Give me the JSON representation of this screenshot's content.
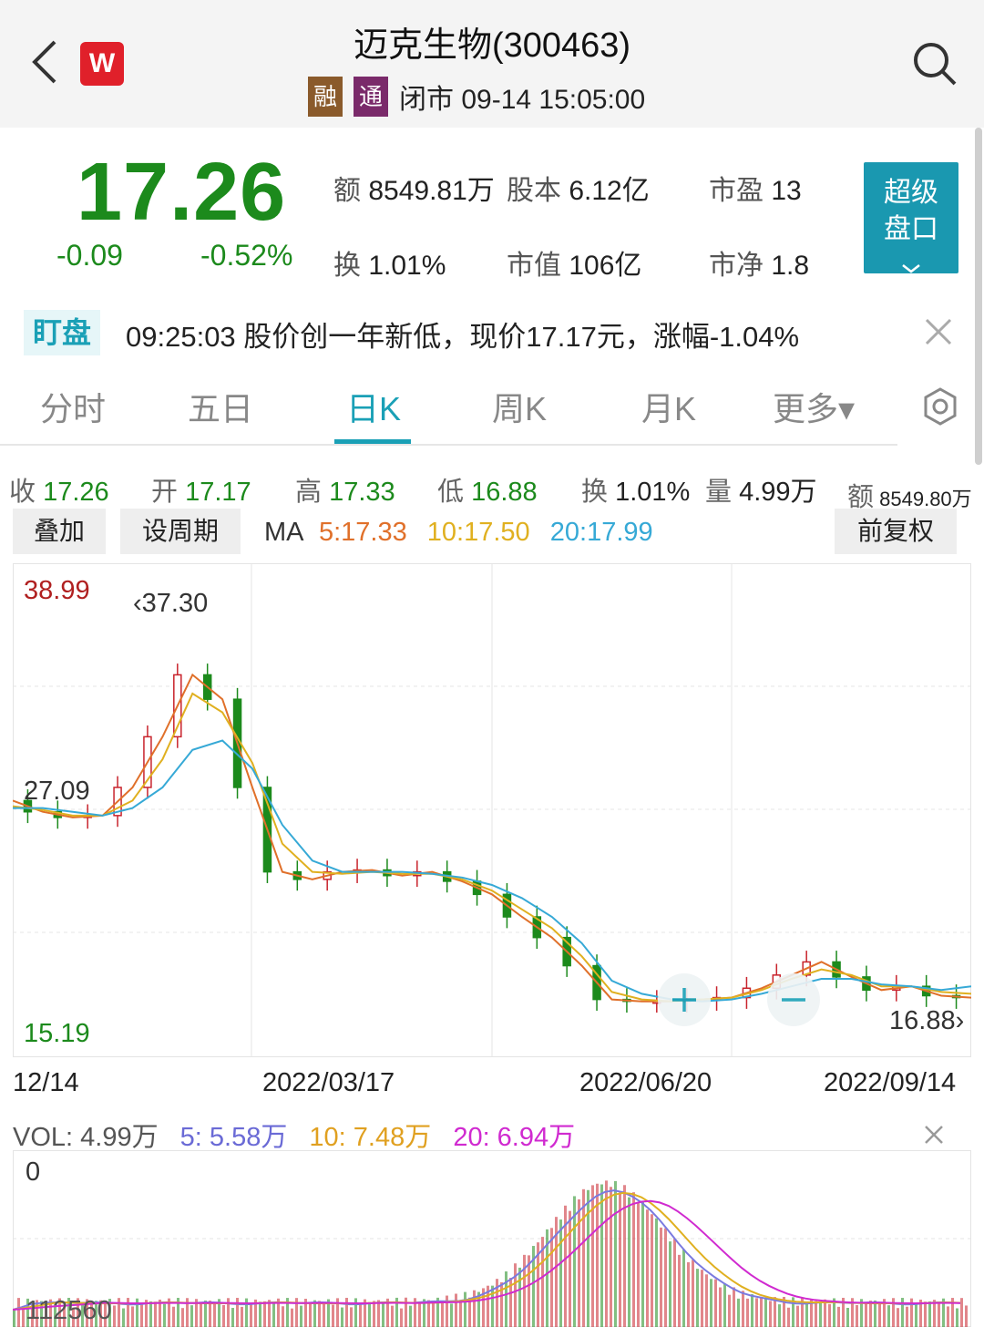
{
  "header": {
    "title": "迈克生物(300463)",
    "tag_rong": "融",
    "tag_tong": "通",
    "status": "闭市 09-14 15:05:00",
    "logo_letter": "W",
    "icons": [
      "back-arrow-icon",
      "search-icon"
    ]
  },
  "quote": {
    "price": "17.26",
    "change": "-0.09",
    "change_pct": "-0.52%",
    "amount_label": "额",
    "amount": "8549.81万",
    "capital_label": "股本",
    "capital": "6.12亿",
    "pe_label": "市盈",
    "pe": "13",
    "turnover_label": "换",
    "turnover": "1.01%",
    "mcap_label": "市值",
    "mcap": "106亿",
    "pb_label": "市净",
    "pb": "1.8",
    "super_line1": "超级",
    "super_line2": "盘口"
  },
  "alert": {
    "badge": "盯盘",
    "text": "09:25:03 股价创一年新低，现价17.17元，涨幅-1.04%"
  },
  "tabs": [
    "分时",
    "五日",
    "日K",
    "周K",
    "月K",
    "更多▾"
  ],
  "active_tab": "日K",
  "ohlc": {
    "close_k": "收",
    "close": "17.26",
    "open_k": "开",
    "open": "17.17",
    "high_k": "高",
    "high": "17.33",
    "low_k": "低",
    "low": "16.88",
    "turn_k": "换",
    "turn": "1.01%",
    "vol_k": "量",
    "vol": "4.99万",
    "amt_k": "额",
    "amt": "8549.80万"
  },
  "toolbar": {
    "overlay": "叠加",
    "period": "设周期",
    "adjust": "前复权"
  },
  "ma": {
    "label": "MA",
    "ma5": "5:17.33",
    "ma10": "10:17.50",
    "ma20": "20:17.99"
  },
  "colors": {
    "up": "#c8232c",
    "down": "#1c8a1c",
    "ma5": "#e0702a",
    "ma10": "#e0b020",
    "ma20": "#36a9d6",
    "vol20": "#d02ad0",
    "vol5": "#7a7ae0",
    "accent": "#1aa0b6"
  },
  "chart_data": {
    "type": "line",
    "y_max_label": "38.99",
    "y_min_label": "15.19",
    "ylim": [
      15.19,
      38.99
    ],
    "annotations": {
      "high": "37.30",
      "mid": "27.09",
      "low": "16.88"
    },
    "x_labels": [
      "2021/12/14",
      "2022/03/17",
      "2022/06/20",
      "2022/09/14"
    ],
    "x_label_display": [
      "12/14",
      "2022/03/17",
      "2022/06/20",
      "2022/09/14"
    ],
    "series": [
      {
        "name": "MA5",
        "values": [
          27.8,
          27.2,
          26.9,
          27.0,
          28.5,
          31.2,
          34.5,
          33.2,
          28.5,
          24.0,
          23.6,
          24.0,
          24.1,
          23.8,
          24.0,
          23.5,
          22.8,
          21.6,
          20.5,
          19.0,
          17.2,
          17.1,
          17.1,
          17.2,
          17.3,
          17.8,
          18.5,
          19.2,
          18.4,
          17.7,
          17.9,
          17.4,
          17.3
        ]
      },
      {
        "name": "MA10",
        "values": [
          27.5,
          27.3,
          27.0,
          27.0,
          27.8,
          30.0,
          33.5,
          32.5,
          29.8,
          25.5,
          24.0,
          23.9,
          24.0,
          23.9,
          23.9,
          23.6,
          23.0,
          22.0,
          21.0,
          19.5,
          17.6,
          17.2,
          17.1,
          17.2,
          17.3,
          17.7,
          18.3,
          18.8,
          18.5,
          17.9,
          17.9,
          17.6,
          17.5
        ]
      },
      {
        "name": "MA20",
        "values": [
          27.4,
          27.4,
          27.2,
          27.0,
          27.4,
          28.5,
          30.5,
          31.0,
          29.5,
          26.5,
          24.6,
          24.0,
          24.0,
          24.0,
          23.9,
          23.7,
          23.3,
          22.6,
          21.6,
          20.2,
          18.2,
          17.5,
          17.2,
          17.1,
          17.2,
          17.5,
          17.9,
          18.3,
          18.3,
          18.0,
          17.9,
          17.7,
          17.9
        ]
      }
    ]
  },
  "volume": {
    "label": "VOL:",
    "vol": "4.99万",
    "vol5": "5: 5.58万",
    "vol10": "10: 7.48万",
    "vol20": "20: 6.94万",
    "y_top_label": "0",
    "y_bottom_label": "112560"
  }
}
